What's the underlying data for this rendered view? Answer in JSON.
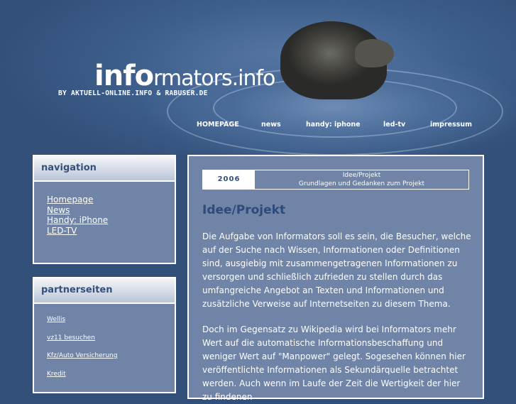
{
  "header": {
    "logo_part1": "info",
    "logo_part2": "rmators.info",
    "tagline": "BY AKTUELL-ONLINE.INFO & RABUSER.DE"
  },
  "topnav": [
    "HOMEPAGE",
    "news",
    "handy: iphone",
    "led-tv",
    "impressum"
  ],
  "navigation": {
    "title": "navigation",
    "items": [
      "Homepage",
      "News",
      "Handy: iPhone",
      "LED-TV"
    ]
  },
  "partners": {
    "title": "partnerseiten",
    "items": [
      "Wellis",
      "vz11 besuchen",
      "Kfz/Auto Versicherung",
      "Kredit"
    ]
  },
  "content": {
    "year": "2006",
    "info_line1": "Idee/Projekt",
    "info_line2": "Grundlagen und Gedanken zum Projekt",
    "heading": "Idee/Projekt",
    "paragraph1": "Die Aufgabe von Informators soll es sein, die Besucher, welche auf der Suche nach Wissen, Informationen oder Definitionen sind, ausgiebig mit zusammengetragenen Informationen zu versorgen und schließlich zufrieden zu stellen durch das umfangreiche Angebot an Texten und Informationen und zusätzliche Verweise auf Internetseiten zu diesem Thema.",
    "paragraph2": "Doch im Gegensatz zu Wikipedia wird bei Informators mehr Wert auf die automatische Informationsbeschaffung und weniger Wert auf \"Manpower\" gelegt. Sogesehen können hier veröffentlichte Informationen als Sekundärquelle betrachtet werden. Auch wenn im Laufe der Zeit die Wertigkeit der hier zu findenen"
  }
}
